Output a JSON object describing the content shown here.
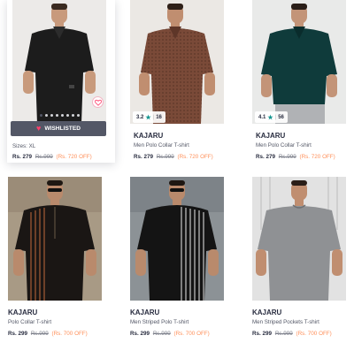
{
  "products": [
    {
      "brand": "",
      "title": "",
      "sizes_label": "Sizes:",
      "sizes_value": "XL",
      "price": "Rs. 279",
      "mrp": "Rs.999",
      "discount": "(Rs. 720 OFF)",
      "wishlist_label": "WISHLISTED",
      "shirt_color": "#1c1c1c",
      "background": "#eceae8"
    },
    {
      "brand": "KAJARU",
      "title": "Men Polo Collar T-shirt",
      "rating": "3.2",
      "rating_count": "16",
      "price": "Rs. 279",
      "mrp": "Rs.999",
      "discount": "(Rs. 720 OFF)",
      "shirt_color": "#7a4a38",
      "background": "#ebe8e4"
    },
    {
      "brand": "KAJARU",
      "title": "Men Polo Collar T-shirt",
      "rating": "4.1",
      "rating_count": "56",
      "price": "Rs. 279",
      "mrp": "Rs.999",
      "discount": "(Rs. 720 OFF)",
      "shirt_color": "#0f3b3b",
      "background": "#e9eae9"
    },
    {
      "brand": "KAJARU",
      "title": "Polo Collar T-shirt",
      "price": "Rs. 299",
      "mrp": "Rs.999",
      "discount": "(Rs. 700 OFF)",
      "shirt_color": "#1a1614",
      "stripe_color": "#8a4f2e",
      "background": "#a89a85"
    },
    {
      "brand": "KAJARU",
      "title": "Men Striped Polo T-shirt",
      "price": "Rs. 299",
      "mrp": "Rs.999",
      "discount": "(Rs. 700 OFF)",
      "shirt_color": "#141414",
      "stripe_color": "#9a9a9a",
      "background": "#8c9296"
    },
    {
      "brand": "KAJARU",
      "title": "Men Striped Pockets T-shirt",
      "price": "Rs. 299",
      "mrp": "Rs.999",
      "discount": "(Rs. 700 OFF)",
      "shirt_color": "#8f9194",
      "background": "#e2e2e2"
    }
  ]
}
